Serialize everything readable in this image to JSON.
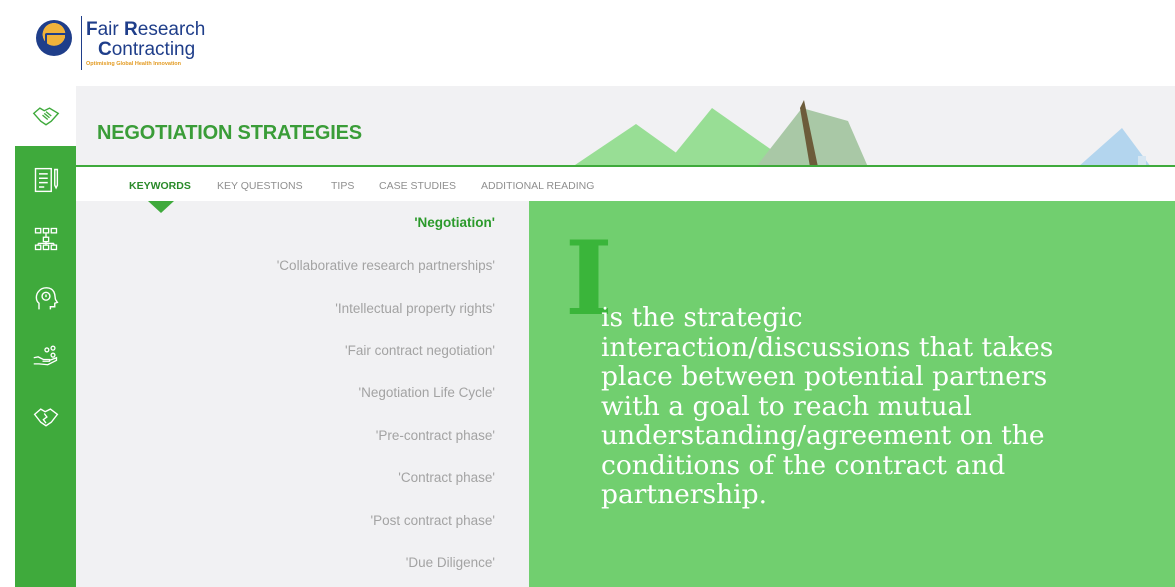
{
  "brand": {
    "line1_cap": "F",
    "line1_rest": "air ",
    "line1_cap2": "R",
    "line1_rest2": "esearch",
    "line2_cap": "C",
    "line2_rest": "ontracting",
    "tagline": "Optimising Global Health Innovation",
    "colors": {
      "navy": "#1f3e8a",
      "gold": "#e39b22",
      "green": "#3faa3c",
      "lightGreen": "#71cf6f"
    }
  },
  "sidebar": {
    "items": [
      {
        "icon": "handshake-icon",
        "active": true
      },
      {
        "icon": "document-pen-icon",
        "active": false
      },
      {
        "icon": "network-icon",
        "active": false
      },
      {
        "icon": "head-idea-icon",
        "active": false
      },
      {
        "icon": "hand-people-icon",
        "active": false
      },
      {
        "icon": "broken-handshake-icon",
        "active": false
      }
    ]
  },
  "header": {
    "title": "NEGOTIATION STRATEGIES"
  },
  "tabs": [
    {
      "label": "KEYWORDS",
      "active": true
    },
    {
      "label": "KEY QUESTIONS",
      "active": false
    },
    {
      "label": "TIPS",
      "active": false
    },
    {
      "label": "CASE STUDIES",
      "active": false
    },
    {
      "label": "ADDITIONAL READING",
      "active": false
    }
  ],
  "keywords": [
    {
      "label": "'Negotiation'",
      "active": true
    },
    {
      "label": "'Collaborative research partnerships'",
      "active": false
    },
    {
      "label": "'Intellectual property rights'",
      "active": false
    },
    {
      "label": "'Fair contract negotiation'",
      "active": false
    },
    {
      "label": "'Negotiation Life Cycle'",
      "active": false
    },
    {
      "label": "'Pre-contract phase'",
      "active": false
    },
    {
      "label": "'Contract phase'",
      "active": false
    },
    {
      "label": "'Post contract phase'",
      "active": false
    },
    {
      "label": "'Due Diligence'",
      "active": false
    }
  ],
  "definition": {
    "dropcap": "I",
    "text": "is the strategic interaction/discussions that takes place between potential partners with a goal to reach mutual understanding/agreement on the conditions of the contract and partnership."
  }
}
